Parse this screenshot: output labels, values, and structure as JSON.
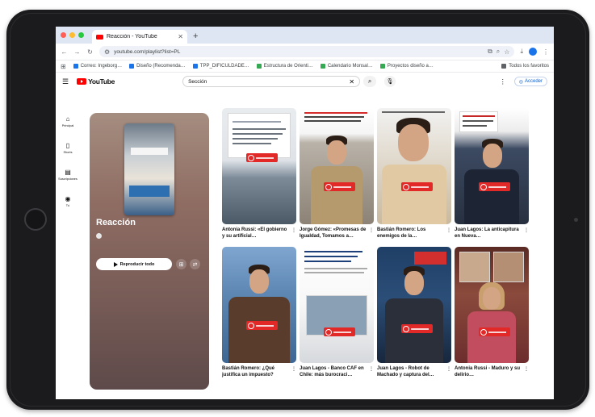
{
  "browser": {
    "tab_title": "Reacción - YouTube",
    "tab_close": "✕",
    "new_tab": "+",
    "url": "youtube.com/playlist?list=PL",
    "nav_back": "←",
    "nav_forward": "→",
    "nav_reload": "↻",
    "bookmarks": [
      {
        "label": "Correo: Ingeborg…",
        "color": "#1a73e8"
      },
      {
        "label": "Diseño (Recomenda…",
        "color": "#1a73e8"
      },
      {
        "label": "TPP_DIFICULDADE…",
        "color": "#1a73e8"
      },
      {
        "label": "Estructura de Orienti…",
        "color": "#34a853"
      },
      {
        "label": "Calendario Monsal…",
        "color": "#34a853"
      },
      {
        "label": "Proyectos diseño a…",
        "color": "#34a853"
      }
    ],
    "bookmarks_all": "Todos los favoritos"
  },
  "youtube": {
    "logo_text": "YouTube",
    "search_value": "Sección",
    "search_clear": "✕",
    "signin_label": "Acceder",
    "rail": [
      {
        "icon": "⌂",
        "label": "Principal"
      },
      {
        "icon": "▯",
        "label": "Shorts"
      },
      {
        "icon": "▤",
        "label": "Suscripciones"
      },
      {
        "icon": "◉",
        "label": "Tú"
      }
    ]
  },
  "playlist": {
    "title": "Reacción",
    "channel": "",
    "meta": "",
    "play_label": "Reproducir todo"
  },
  "shorts": [
    {
      "title": "Antonia Russi: «El gobierno y su artificial…"
    },
    {
      "title": "Jorge Gómez: «Promesas de Igualdad, Tomamos a…"
    },
    {
      "title": "Bastián Romero: Los enemigos de la…"
    },
    {
      "title": "Juan Lagos: La anticapitura en Nueva…"
    },
    {
      "title": "Bastián Romero: ¿Qué justifica un impuesto?"
    },
    {
      "title": "Juan Lagos - Banco CAF en Chile: más burocraci…"
    },
    {
      "title": "Juan Lagos - Robot de Machado y captura del…"
    },
    {
      "title": "Antonia Russi - Maduro y su delirio…"
    }
  ]
}
